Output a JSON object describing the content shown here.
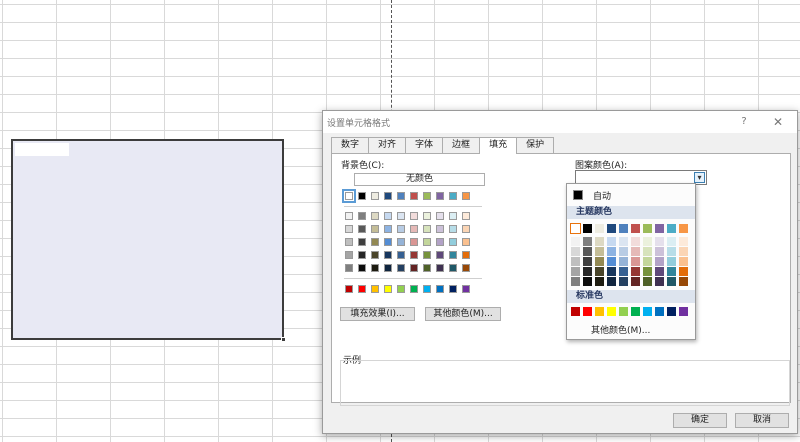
{
  "dialog": {
    "title": "设置单元格格式",
    "help_glyph": "?",
    "close_glyph": "✕",
    "tabs": [
      {
        "label": "数字",
        "active": false
      },
      {
        "label": "对齐",
        "active": false
      },
      {
        "label": "字体",
        "active": false
      },
      {
        "label": "边框",
        "active": false
      },
      {
        "label": "填充",
        "active": true
      },
      {
        "label": "保护",
        "active": false
      }
    ],
    "background_color_label": "背景色(C):",
    "no_color_label": "无颜色",
    "fill_effects_label": "填充效果(I)...",
    "more_colors_label": "其他颜色(M)...",
    "pattern_color_label": "图案颜色(A):",
    "example_label": "示例",
    "ok_label": "确定",
    "cancel_label": "取消"
  },
  "color_picker": {
    "automatic_label": "自动",
    "theme_colors_label": "主题颜色",
    "standard_colors_label": "标准色",
    "more_colors_label": "其他颜色(M)..."
  },
  "palette": {
    "theme_top": [
      "#FFFFFF",
      "#000000",
      "#EEECE1",
      "#1F497D",
      "#4F81BD",
      "#C0504D",
      "#9BBB59",
      "#8064A2",
      "#4BACC6",
      "#F79646"
    ],
    "theme_shades": [
      [
        "#F2F2F2",
        "#7F7F7F",
        "#DDD9C3",
        "#C6D9F0",
        "#DBE5F1",
        "#F2DCDB",
        "#EBF1DD",
        "#E5E0EC",
        "#DBEEF3",
        "#FDEADA"
      ],
      [
        "#D8D8D8",
        "#595959",
        "#C4BD97",
        "#8DB3E2",
        "#B8CCE4",
        "#E5B9B7",
        "#D7E3BC",
        "#CCC1D9",
        "#B7DDE8",
        "#FBD5B5"
      ],
      [
        "#BFBFBF",
        "#3F3F3F",
        "#938953",
        "#548DD4",
        "#95B3D7",
        "#D99694",
        "#C3D69B",
        "#B2A2C7",
        "#92CDDC",
        "#FAC08F"
      ],
      [
        "#A5A5A5",
        "#262626",
        "#494429",
        "#17365D",
        "#366092",
        "#953734",
        "#76923C",
        "#5F497A",
        "#31859B",
        "#E36C09"
      ],
      [
        "#7F7F7F",
        "#0C0C0C",
        "#1D1B10",
        "#0F243E",
        "#244061",
        "#632423",
        "#4F6128",
        "#3F3151",
        "#205867",
        "#974806"
      ]
    ],
    "standard": [
      "#C00000",
      "#FF0000",
      "#FFC000",
      "#FFFF00",
      "#92D050",
      "#00B050",
      "#00B0F0",
      "#0070C0",
      "#002060",
      "#7030A0"
    ],
    "selection_outline": "#5B9BD5",
    "picker_selection_outline": "#E8720C",
    "range_fill": "#E8E9F4"
  },
  "icons": {
    "dropdown_arrow": "chevron-down-icon"
  }
}
